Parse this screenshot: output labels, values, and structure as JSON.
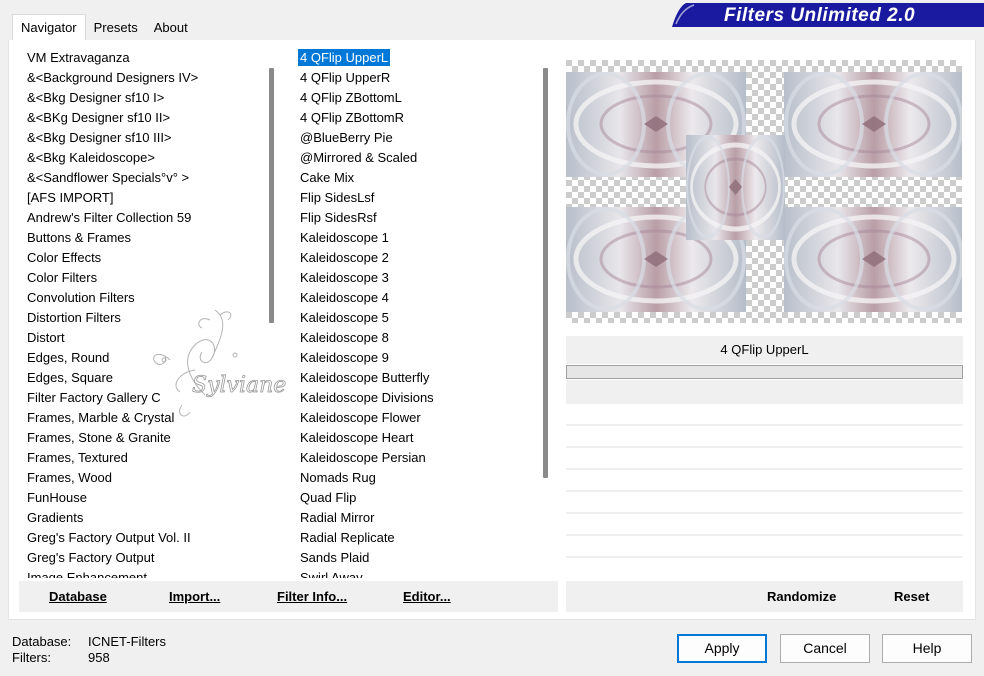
{
  "tabs": [
    {
      "label": "Navigator",
      "active": true
    },
    {
      "label": "Presets",
      "active": false
    },
    {
      "label": "About",
      "active": false
    }
  ],
  "logo": {
    "title": "Filters Unlimited 2.0",
    "color": "#1a1aa0"
  },
  "categories": [
    " VM Extravaganza",
    "&<Background Designers IV>",
    "&<Bkg Designer sf10 I>",
    "&<BKg Designer sf10 II>",
    "&<Bkg Designer sf10 III>",
    "&<Bkg Kaleidoscope>",
    "&<Sandflower Specials°v° >",
    "[AFS IMPORT]",
    "Andrew's Filter Collection 59",
    "Buttons & Frames",
    "Color Effects",
    "Color Filters",
    "Convolution Filters",
    "Distortion Filters",
    "Distort",
    "Edges, Round",
    "Edges, Square",
    "Filter Factory Gallery C",
    "Frames, Marble & Crystal",
    "Frames, Stone & Granite",
    "Frames, Textured",
    "Frames, Wood",
    "FunHouse",
    "Gradients",
    "Greg's Factory Output Vol. II",
    "Greg's Factory Output",
    "Image Enhancement"
  ],
  "filters": [
    "4 QFlip UpperL",
    "4 QFlip UpperR",
    "4 QFlip ZBottomL",
    "4 QFlip ZBottomR",
    "@BlueBerry Pie",
    "@Mirrored & Scaled",
    "Cake Mix",
    "Flip SidesLsf",
    "Flip SidesRsf",
    "Kaleidoscope 1",
    "Kaleidoscope 2",
    "Kaleidoscope 3",
    "Kaleidoscope 4",
    "Kaleidoscope 5",
    "Kaleidoscope 8",
    "Kaleidoscope 9",
    "Kaleidoscope Butterfly",
    "Kaleidoscope Divisions",
    "Kaleidoscope Flower",
    "Kaleidoscope Heart",
    "Kaleidoscope Persian",
    "Nomads Rug",
    "Quad Flip",
    "Radial Mirror",
    "Radial Replicate",
    "Sands Plaid",
    "Swirl Away"
  ],
  "selected_filter": "4 QFlip UpperL",
  "preview": {
    "label": "4 QFlip UpperL"
  },
  "left_buttons": {
    "database": "Database",
    "import": "Import...",
    "filter_info": "Filter Info...",
    "editor": "Editor..."
  },
  "right_buttons": {
    "randomize": "Randomize",
    "reset": "Reset"
  },
  "info": {
    "db_label": "Database:",
    "db_value": "ICNET-Filters",
    "filters_label": "Filters:",
    "filters_value": "958"
  },
  "dialog_buttons": {
    "apply": "Apply",
    "cancel": "Cancel",
    "help": "Help"
  },
  "watermark": {
    "text": "Sylviane"
  },
  "colors": {
    "selection": "#0078d7",
    "logo_bg": "#1a1aa0"
  }
}
